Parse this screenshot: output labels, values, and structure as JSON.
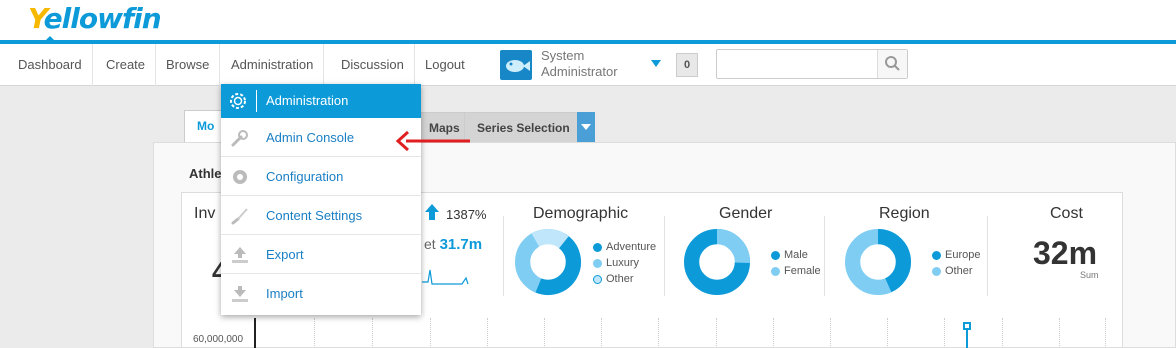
{
  "logo": {
    "first_letter": "Y",
    "rest": "ellowfin"
  },
  "nav": {
    "items": [
      {
        "label": "Dashboard"
      },
      {
        "label": "Create"
      },
      {
        "label": "Browse"
      },
      {
        "label": "Administration"
      },
      {
        "label": "Discussion"
      },
      {
        "label": "Logout"
      }
    ]
  },
  "user": {
    "line1": "System",
    "line2": "Administrator",
    "notifications": "0"
  },
  "search": {
    "placeholder": ""
  },
  "tabs": {
    "first": "Mo",
    "maps": "Maps",
    "series": "Series Selection"
  },
  "panel": {
    "title": "Athle"
  },
  "dashboard": {
    "invested_label": "Inv",
    "invested_value": "4",
    "kpi_pct": "1387%",
    "target_prefix": "et",
    "target_value": "31.7m",
    "demographic": {
      "title": "Demographic",
      "legend": [
        "Adventure",
        "Luxury",
        "Other"
      ]
    },
    "gender": {
      "title": "Gender",
      "legend": [
        "Male",
        "Female"
      ]
    },
    "region": {
      "title": "Region",
      "legend": [
        "Europe",
        "Other"
      ]
    },
    "cost": {
      "title": "Cost",
      "value": "32m",
      "sub": "Sum"
    },
    "y_axis_top": "60,000,000"
  },
  "menu": {
    "header": "Administration",
    "items": [
      {
        "label": "Admin Console",
        "icon": "wrench-icon"
      },
      {
        "label": "Configuration",
        "icon": "gear-icon"
      },
      {
        "label": "Content Settings",
        "icon": "brush-icon"
      },
      {
        "label": "Export",
        "icon": "upload-icon"
      },
      {
        "label": "Import",
        "icon": "download-icon"
      }
    ]
  },
  "colors": {
    "accent": "#0d9ad9",
    "light": "#7fcdf2",
    "pale": "#bfe6fa",
    "logo_y": "#f7b800"
  }
}
